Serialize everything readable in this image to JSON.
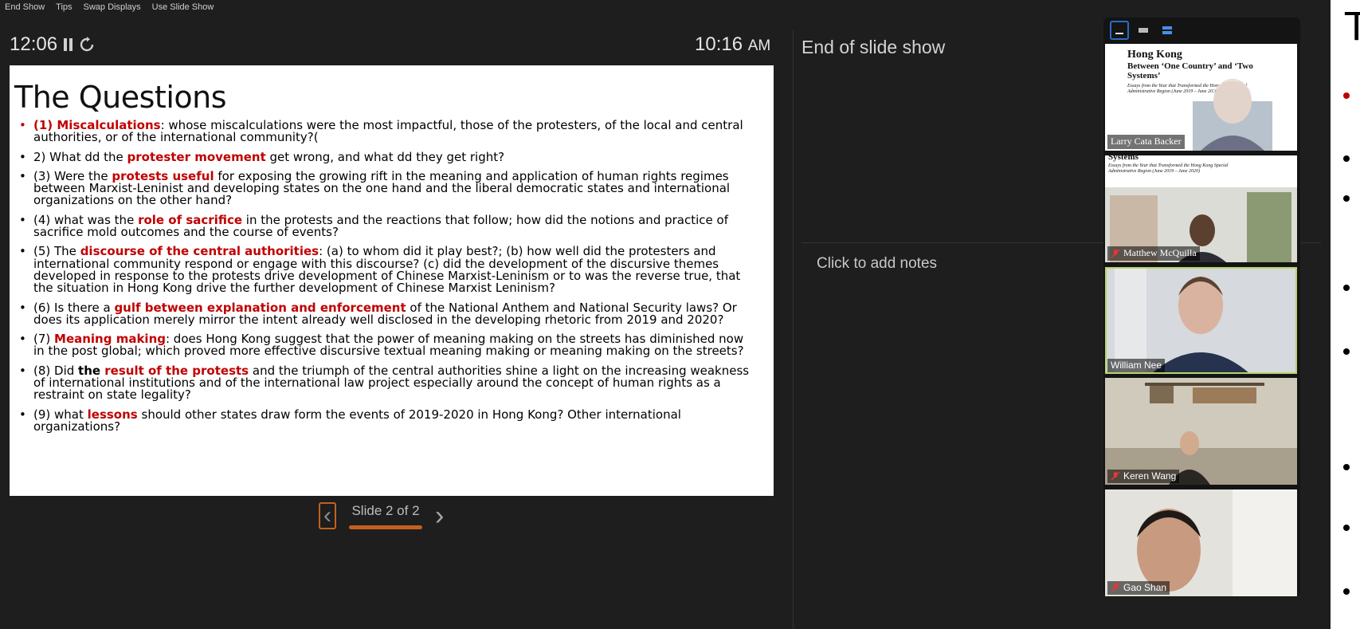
{
  "menu": [
    "End Show",
    "Tips",
    "Swap Displays",
    "Use Slide Show"
  ],
  "timer": "12:06",
  "clock": {
    "time": "10:16",
    "ampm": "AM"
  },
  "slide": {
    "title": "The Questions",
    "items": [
      {
        "parts": [
          {
            "t": "(1) Miscalculations",
            "s": "hl"
          },
          {
            "t": ": whose miscalculations were the most impactful, those of the protesters, of the local and central authorities, or of the international community?("
          }
        ],
        "red": true
      },
      {
        "parts": [
          {
            "t": "2) What dd the "
          },
          {
            "t": "protester movement",
            "s": "hl"
          },
          {
            "t": " get wrong, and what dd they get right?"
          }
        ]
      },
      {
        "parts": [
          {
            "t": "(3) Were the "
          },
          {
            "t": "protests useful",
            "s": "hl"
          },
          {
            "t": " for exposing the growing rift in the meaning and application of human rights regimes between Marxist-Leninist and developing states on the one hand and the liberal democratic states and international organizations on the other hand?"
          }
        ]
      },
      {
        "parts": [
          {
            "t": "(4) what was the "
          },
          {
            "t": "role of sacrifice",
            "s": "hl"
          },
          {
            "t": " in the protests and the reactions that follow; how did the notions and practice of sacrifice mold outcomes and the course of events?"
          }
        ]
      },
      {
        "parts": [
          {
            "t": "(5) The "
          },
          {
            "t": "discourse of the central authorities",
            "s": "hl"
          },
          {
            "t": ": (a)  to whom did it play best?; (b) how well did  the protesters and international community respond or engage with this discourse? (c)  did the development of the discursive themes developed in response to the protests drive development of Chinese Marxist-Leninism or to was the reverse true, that the situation in Hong Kong drive the further development of Chinese Marxist Leninism?"
          }
        ]
      },
      {
        "parts": [
          {
            "t": "(6) Is there a "
          },
          {
            "t": "gulf between explanation and enforcement",
            "s": "hl"
          },
          {
            "t": " of the National Anthem and National Security laws?  Or does its application merely mirror the intent already well disclosed in the developing rhetoric from 2019 and 2020?"
          }
        ]
      },
      {
        "parts": [
          {
            "t": "(7) "
          },
          {
            "t": "Meaning making",
            "s": "hl"
          },
          {
            "t": ": does Hong Kong suggest that the power of meaning making on the streets has diminished now in the post global; which proved more effective discursive textual meaning making or meaning making on the streets?"
          }
        ]
      },
      {
        "parts": [
          {
            "t": "(8) Did "
          },
          {
            "t": "the ",
            "s": "bold"
          },
          {
            "t": "result of the protests",
            "s": "hl"
          },
          {
            "t": " and the triumph of the central authorities shine a light on the increasing weakness of international institutions and of the international law project especially around the concept of human rights as a restraint on state legality?"
          }
        ]
      },
      {
        "parts": [
          {
            "t": "(9) what "
          },
          {
            "t": "lessons",
            "s": "hl"
          },
          {
            "t": " should other states draw form the events of 2019-2020 in Hong Kong? Other international organizations?"
          }
        ]
      }
    ]
  },
  "nav": {
    "label": "Slide 2 of 2",
    "progress": 1.0
  },
  "next_slide_label": "End of slide show",
  "notes_placeholder": "Click to add notes",
  "book_cover": {
    "title": "Hong Kong",
    "subtitle": "Between ‘One Country’ and ‘Two Systems’",
    "tagline": "Essays from the Year that Transformed the Hong Kong Special Administrative Region (June 2019 – June 2020)",
    "partial_word": "Systems"
  },
  "participants": [
    {
      "name": "Larry Cata Backer",
      "muted": false,
      "active": false
    },
    {
      "name": "Matthew McQuilla",
      "muted": true,
      "active": false
    },
    {
      "name": "William Nee",
      "muted": false,
      "active": true
    },
    {
      "name": "Keren Wang",
      "muted": true,
      "active": false
    },
    {
      "name": "Gao Shan",
      "muted": true,
      "active": false
    }
  ],
  "colors": {
    "accent": "#c2611e",
    "highlight_red": "#c00000",
    "active_speaker": "#b7d46a",
    "view_active": "#2a6cc9"
  }
}
